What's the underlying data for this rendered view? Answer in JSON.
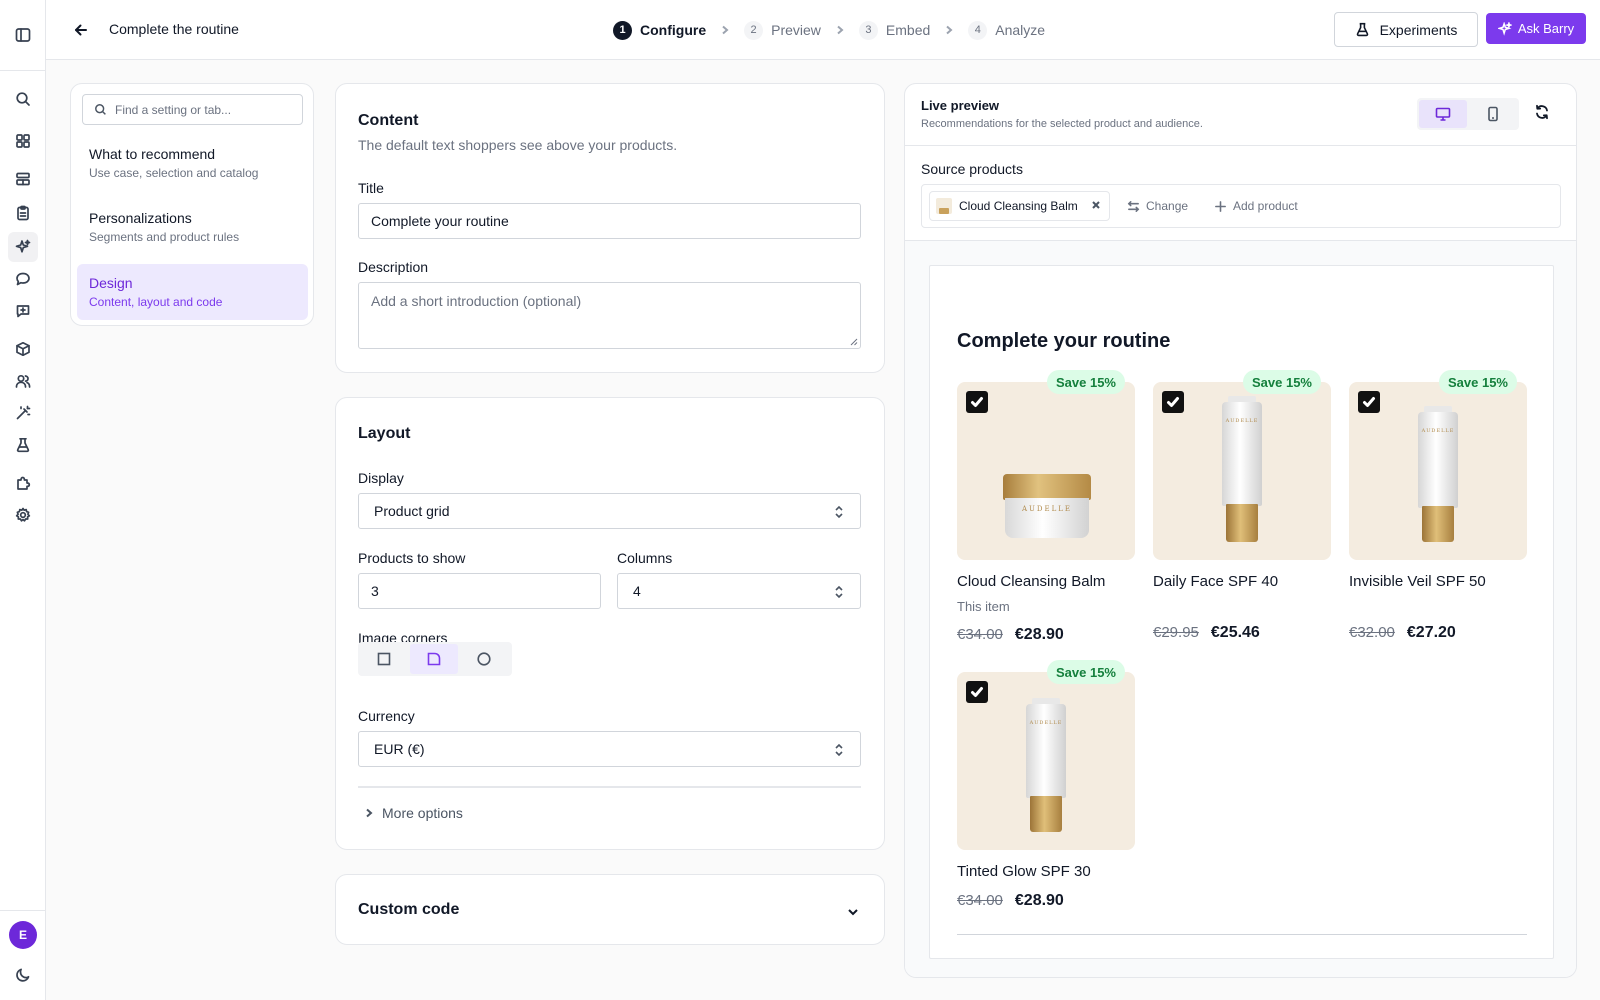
{
  "header": {
    "title": "Complete the routine",
    "steps": [
      {
        "num": "1",
        "label": "Configure"
      },
      {
        "num": "2",
        "label": "Preview"
      },
      {
        "num": "3",
        "label": "Embed"
      },
      {
        "num": "4",
        "label": "Analyze"
      }
    ],
    "active_step": 0,
    "experiments_label": "Experiments",
    "ask_barry_label": "Ask Barry"
  },
  "rail": {
    "icons": [
      "sidebar-toggle-icon",
      "search-icon",
      "dashboard-icon",
      "layout-icon",
      "clipboard-icon",
      "sparkle-icon",
      "chat-icon",
      "message-square-icon",
      "box-icon",
      "users-icon",
      "magic-wand-icon",
      "flask-icon",
      "puzzle-icon",
      "settings-icon"
    ],
    "active_icon": "sparkle-icon",
    "avatar_initial": "E",
    "bottom_icon": "moon-icon"
  },
  "settings_nav": {
    "search_placeholder": "Find a setting or tab...",
    "items": [
      {
        "title": "What to recommend",
        "subtitle": "Use case, selection and catalog",
        "active": false
      },
      {
        "title": "Personalizations",
        "subtitle": "Segments and product rules",
        "active": false
      },
      {
        "title": "Design",
        "subtitle": "Content, layout and code",
        "active": true
      }
    ]
  },
  "content_card": {
    "heading": "Content",
    "subheading": "The default text shoppers see above your products.",
    "title_label": "Title",
    "title_value": "Complete your routine",
    "description_label": "Description",
    "description_placeholder": "Add a short introduction (optional)"
  },
  "layout_card": {
    "heading": "Layout",
    "display_label": "Display",
    "display_value": "Product grid",
    "products_label": "Products to show",
    "products_value": "3",
    "columns_label": "Columns",
    "columns_value": "4",
    "corners_label": "Image corners",
    "corner_options": [
      "square-corners-icon",
      "rounded-corners-icon",
      "circle-corners-icon"
    ],
    "corner_selected": 1,
    "currency_label": "Currency",
    "currency_value": "EUR (€)",
    "more_options_label": "More options"
  },
  "custom_code_card": {
    "heading": "Custom code"
  },
  "preview": {
    "title": "Live preview",
    "subtitle": "Recommendations for the selected product and audience.",
    "device": "desktop",
    "source_label": "Source products",
    "source_chip": "Cloud Cleansing Balm",
    "change_label": "Change",
    "add_label": "Add product",
    "widget_title": "Complete your routine",
    "brand_mark": "AUDELLE",
    "products": [
      {
        "name": "Cloud Cleansing Balm",
        "note": "This item",
        "badge": "Save 15%",
        "old_price": "€34.00",
        "new_price": "€28.90",
        "image": "jar",
        "checked": true
      },
      {
        "name": "Daily Face SPF 40",
        "note": "",
        "badge": "Save 15%",
        "old_price": "€29.95",
        "new_price": "€25.46",
        "image": "tube",
        "checked": true
      },
      {
        "name": "Invisible Veil SPF 50",
        "note": "",
        "badge": "Save 15%",
        "old_price": "€32.00",
        "new_price": "€27.20",
        "image": "tube",
        "checked": true
      },
      {
        "name": "Tinted Glow SPF 30",
        "note": "",
        "badge": "Save 15%",
        "old_price": "€34.00",
        "new_price": "€28.90",
        "image": "tube",
        "checked": true
      }
    ]
  },
  "colors": {
    "accent": "#7c3aed",
    "accent_soft": "#ede9fe",
    "badge_bg": "#dcfce7",
    "badge_text": "#15803d",
    "product_bg": "#f4ece0"
  }
}
